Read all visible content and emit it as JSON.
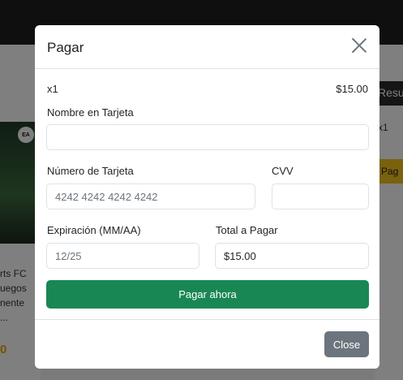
{
  "background": {
    "left_card_lines": [
      "rts FC",
      "uegos",
      "nente",
      "..."
    ],
    "left_price": "0",
    "right_card_title": "Resu",
    "right_card_qty": "x1",
    "right_card_button": "Pag",
    "badge": "EA"
  },
  "modal": {
    "title": "Pagar",
    "item_qty": "x1",
    "item_price": "$15.00",
    "card_name_label": "Nombre en Tarjeta",
    "card_name_value": "",
    "card_number_label": "Número de Tarjeta",
    "card_number_placeholder": "4242 4242 4242 4242",
    "cvv_label": "CVV",
    "cvv_value": "",
    "expiry_label": "Expiración (MM/AA)",
    "expiry_placeholder": "12/25",
    "total_label": "Total a Pagar",
    "total_value": "$15.00",
    "pay_button": "Pagar ahora",
    "close_button": "Close"
  },
  "colors": {
    "primary_green": "#198754",
    "secondary_gray": "#6c757d",
    "accent_yellow": "#f2c21c"
  }
}
